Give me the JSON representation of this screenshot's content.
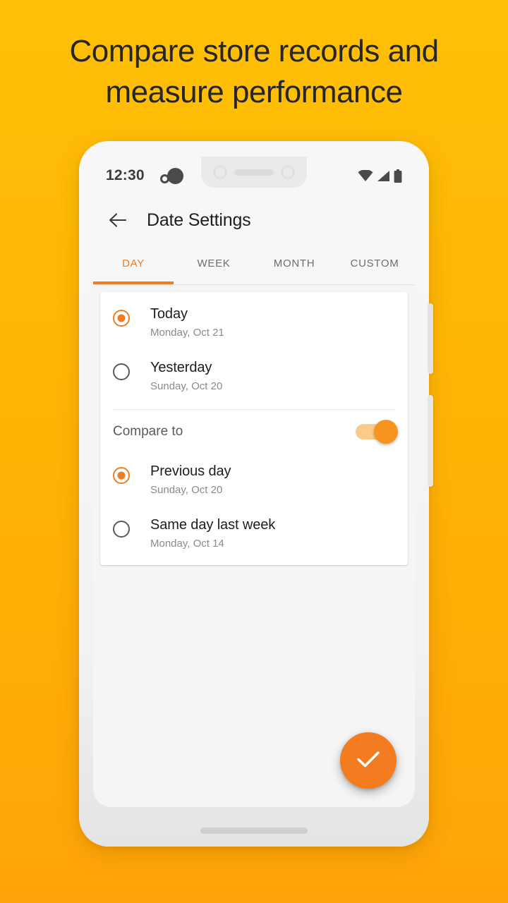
{
  "headline": {
    "line1": "Compare store records and",
    "line2": "measure performance"
  },
  "colors": {
    "background_top": "#FFC006",
    "background_bottom": "#FFA408",
    "accent": "#EE7D23",
    "fab": "#F47C20",
    "switch_track": "#FBCB8A",
    "switch_thumb": "#F7941D",
    "screen_bg": "#F5F5F5",
    "card_bg": "#FFFFFF"
  },
  "statusbar": {
    "time": "12:30",
    "icons": {
      "notification": "notification-dots-icon",
      "wifi": "wifi-icon",
      "signal": "cellular-signal-icon",
      "battery": "battery-full-icon"
    }
  },
  "appbar": {
    "back_icon": "back-arrow-icon",
    "title": "Date Settings"
  },
  "tabs": {
    "items": [
      {
        "label": "DAY",
        "active": true
      },
      {
        "label": "WEEK",
        "active": false
      },
      {
        "label": "MONTH",
        "active": false
      },
      {
        "label": "CUSTOM",
        "active": false
      }
    ]
  },
  "main": {
    "date_options": [
      {
        "title": "Today",
        "subtitle": "Monday, Oct 21",
        "selected": true
      },
      {
        "title": "Yesterday",
        "subtitle": "Sunday, Oct 20",
        "selected": false
      }
    ],
    "compare": {
      "label": "Compare to",
      "enabled": true,
      "options": [
        {
          "title": "Previous day",
          "subtitle": "Sunday, Oct 20",
          "selected": true
        },
        {
          "title": "Same day last week",
          "subtitle": "Monday, Oct 14",
          "selected": false
        }
      ]
    }
  },
  "fab": {
    "icon": "check-icon",
    "label": "Confirm"
  }
}
